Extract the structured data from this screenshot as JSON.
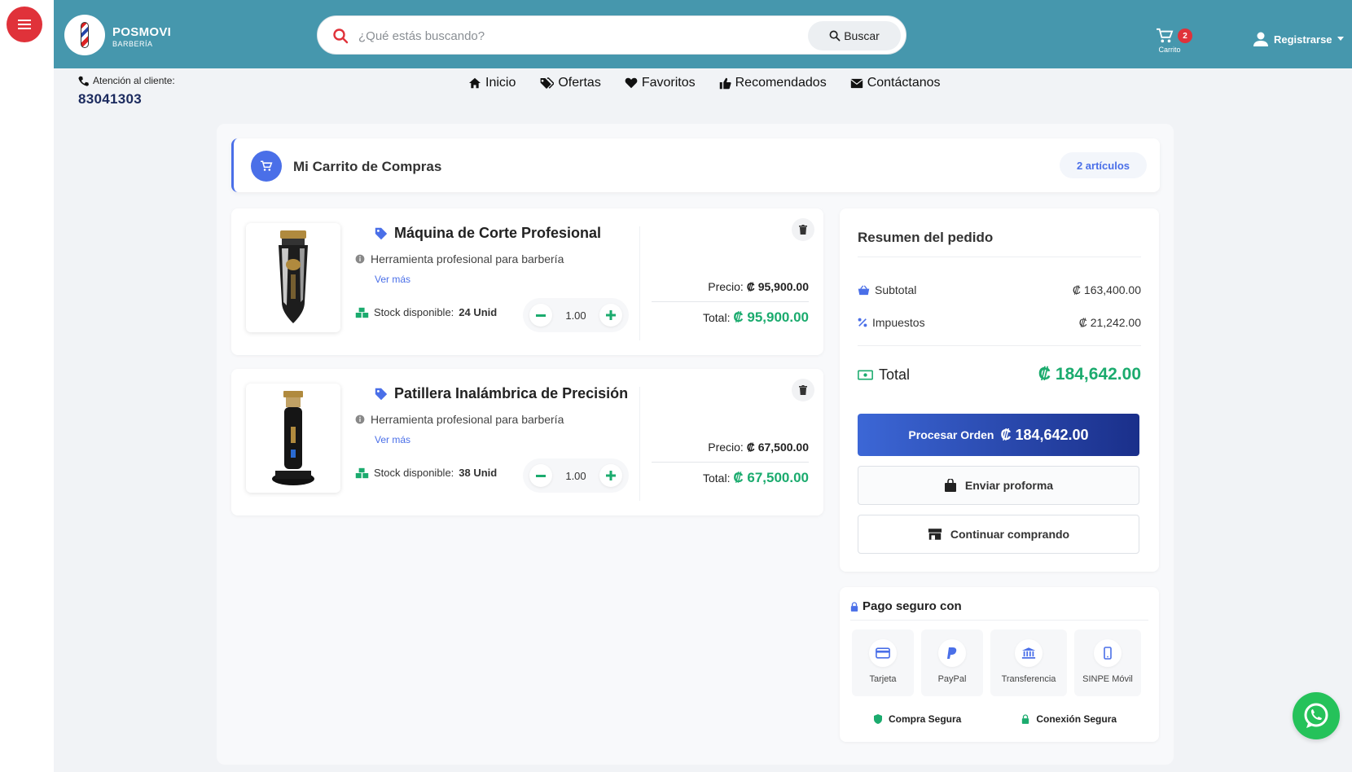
{
  "brand": {
    "name": "POSMOVI",
    "subtitle": "BARBERÍA"
  },
  "search": {
    "placeholder": "¿Qué estás buscando?",
    "button_label": "Buscar"
  },
  "header": {
    "cart_label": "Carrito",
    "cart_count": "2",
    "register_label": "Registrarse"
  },
  "support": {
    "label": "Atención al cliente:",
    "phone": "83041303"
  },
  "nav": {
    "items": [
      {
        "label": "Inicio",
        "icon": "home-icon"
      },
      {
        "label": "Ofertas",
        "icon": "tags-icon"
      },
      {
        "label": "Favoritos",
        "icon": "heart-icon"
      },
      {
        "label": "Recomendados",
        "icon": "thumbs-up-icon"
      },
      {
        "label": "Contáctanos",
        "icon": "envelope-icon"
      }
    ]
  },
  "cart": {
    "title": "Mi Carrito de Compras",
    "items_count": "2 artículos",
    "price_label": "Precio:",
    "total_label": "Total:",
    "see_more": "Ver más",
    "stock_label": "Stock disponible:",
    "items": [
      {
        "name": "Máquina de Corte Profesional",
        "description": "Herramienta profesional para barbería",
        "stock": "24 Unid",
        "quantity": "1.00",
        "price": "₡ 95,900.00",
        "total": "₡ 95,900.00"
      },
      {
        "name": "Patillera Inalámbrica de Precisión",
        "description": "Herramienta profesional para barbería",
        "stock": "38 Unid",
        "quantity": "1.00",
        "price": "₡ 67,500.00",
        "total": "₡ 67,500.00"
      }
    ]
  },
  "summary": {
    "title": "Resumen del pedido",
    "subtotal_label": "Subtotal",
    "subtotal": "₡ 163,400.00",
    "tax_label": "Impuestos",
    "tax": "₡ 21,242.00",
    "total_label": "Total",
    "total": "₡ 184,642.00",
    "process_label": "Procesar Orden",
    "process_amount": "₡ 184,642.00",
    "proforma_label": "Enviar proforma",
    "continue_label": "Continuar comprando"
  },
  "payment": {
    "title": "Pago seguro con",
    "methods": [
      {
        "label": "Tarjeta",
        "icon": "credit-card-icon"
      },
      {
        "label": "PayPal",
        "icon": "paypal-icon"
      },
      {
        "label": "Transferencia",
        "icon": "bank-icon"
      },
      {
        "label": "SINPE Móvil",
        "icon": "mobile-icon"
      }
    ],
    "badge_secure": "Compra Segura",
    "badge_connection": "Conexión Segura"
  },
  "colors": {
    "header": "#4697ad",
    "accent_blue": "#4a6fe8",
    "accent_green": "#1bab6e",
    "menu_red": "#e0323a",
    "whatsapp": "#25c25a"
  }
}
